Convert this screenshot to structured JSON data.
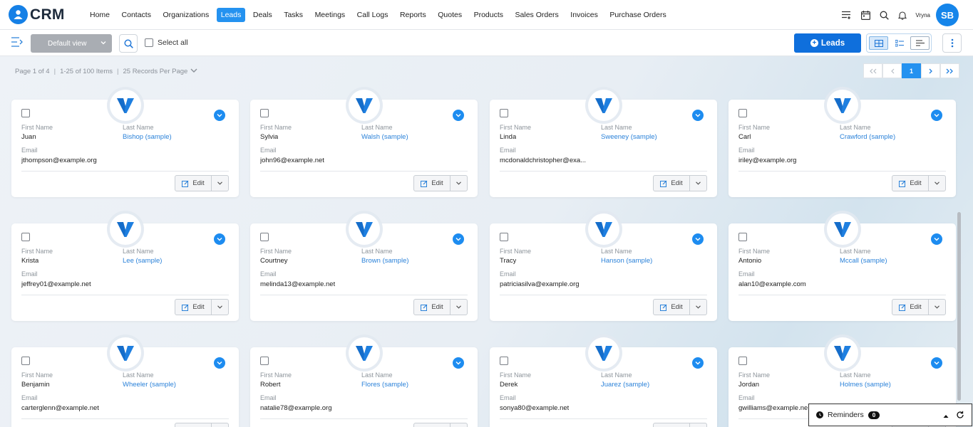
{
  "brand": {
    "name": "CRM"
  },
  "nav": {
    "items": [
      "Home",
      "Contacts",
      "Organizations",
      "Leads",
      "Deals",
      "Tasks",
      "Meetings",
      "Call Logs",
      "Reports",
      "Quotes",
      "Products",
      "Sales Orders",
      "Invoices",
      "Purchase Orders"
    ],
    "active": "Leads",
    "user_name": "Vryna",
    "user_initials": "SB",
    "icons": [
      "list-add-icon",
      "calendar-icon",
      "search-icon",
      "bell-icon"
    ]
  },
  "toolbar": {
    "view_label": "Default view",
    "select_all_label": "Select all",
    "add_button_label": "Leads",
    "view_modes": [
      "grid-view-icon",
      "list-view-icon",
      "kanban-view-icon"
    ],
    "active_view": "grid-view-icon"
  },
  "pagination": {
    "page_text": "Page 1 of 4",
    "range_text": "1-25 of 100 Items",
    "per_page_text": "25 Records Per Page",
    "current_page": "1"
  },
  "labels": {
    "first_name": "First Name",
    "last_name": "Last Name",
    "email": "Email",
    "edit": "Edit"
  },
  "leads": [
    {
      "first": "Juan",
      "last": "Bishop (sample)",
      "email": "jthompson@example.org"
    },
    {
      "first": "Sylvia",
      "last": "Walsh (sample)",
      "email": "john96@example.net"
    },
    {
      "first": "Linda",
      "last": "Sweeney (sample)",
      "email": "mcdonaldchristopher@exa..."
    },
    {
      "first": "Carl",
      "last": "Crawford (sample)",
      "email": "iriley@example.org"
    },
    {
      "first": "Krista",
      "last": "Lee (sample)",
      "email": "jeffrey01@example.net"
    },
    {
      "first": "Courtney",
      "last": "Brown (sample)",
      "email": "melinda13@example.net"
    },
    {
      "first": "Tracy",
      "last": "Hanson (sample)",
      "email": "patriciasilva@example.org"
    },
    {
      "first": "Antonio",
      "last": "Mccall (sample)",
      "email": "alan10@example.com"
    },
    {
      "first": "Benjamin",
      "last": "Wheeler (sample)",
      "email": "carterglenn@example.net"
    },
    {
      "first": "Robert",
      "last": "Flores (sample)",
      "email": "natalie78@example.org"
    },
    {
      "first": "Derek",
      "last": "Juarez (sample)",
      "email": "sonya80@example.net"
    },
    {
      "first": "Jordan",
      "last": "Holmes (sample)",
      "email": "gwilliams@example.ne..."
    }
  ],
  "reminders": {
    "label": "Reminders",
    "count": "0"
  },
  "colors": {
    "accent": "#2492f0",
    "primary_button": "#0f6fdc",
    "link": "#2b82d9"
  }
}
